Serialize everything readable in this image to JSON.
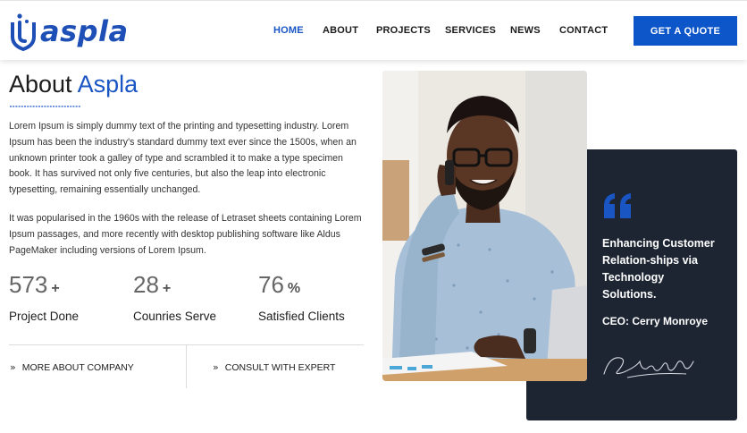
{
  "brand": {
    "name": "aspla",
    "color": "#1e4fb7"
  },
  "nav": {
    "items": [
      {
        "label": "HOME",
        "active": true
      },
      {
        "label": "ABOUT",
        "active": false
      },
      {
        "label": "PROJECTS",
        "active": false
      },
      {
        "label": "SERVICES",
        "active": false
      },
      {
        "label": "NEWS",
        "active": false
      },
      {
        "label": "CONTACT",
        "active": false
      }
    ],
    "cta_label": "GET A QUOTE"
  },
  "about": {
    "title_prefix": "About ",
    "title_accent": "Aspla",
    "paragraph1": "Lorem Ipsum is simply dummy text of the printing and typesetting industry. Lorem Ipsum has been the industry's standard dummy text ever since the 1500s, when an unknown printer took a galley of type and scrambled it to make a type specimen book. It has survived not only five centuries, but also the leap into electronic typesetting, remaining essentially unchanged.",
    "paragraph2": "It was popularised in the 1960s with the release of Letraset sheets containing Lorem Ipsum passages, and more recently with desktop publishing software like Aldus PageMaker including versions of Lorem Ipsum."
  },
  "stats": [
    {
      "value": "573",
      "suffix": "+",
      "label": "Project Done"
    },
    {
      "value": "28",
      "suffix": "+",
      "label": "Counries Serve"
    },
    {
      "value": "76",
      "suffix": "%",
      "label": "Satisfied Clients"
    }
  ],
  "links": {
    "more": "MORE ABOUT COMPANY",
    "consult": "CONSULT WITH EXPERT"
  },
  "card": {
    "quote": "Enhancing Customer Relation-ships via Technology Solutions.",
    "ceo": "CEO: Cerry Monroye"
  },
  "colors": {
    "accent": "#1a55c4",
    "cta": "#0d56c9",
    "card": "#1d2533"
  }
}
